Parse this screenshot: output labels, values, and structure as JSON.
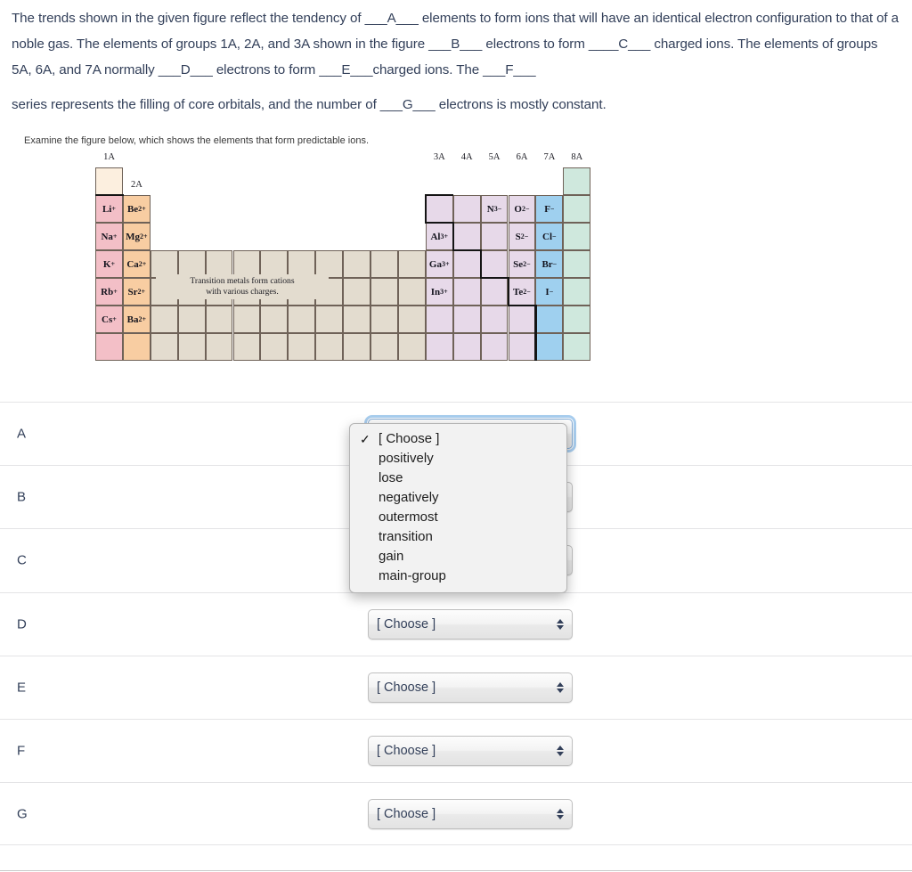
{
  "question": {
    "paragraph1": "The trends shown in the given figure reflect the tendency of ___A___ elements to form ions that will have an identical electron configuration to that of a noble gas. The elements of groups 1A, 2A, and 3A shown in the figure ___B___ electrons to form ____C___ charged ions. The elements of groups 5A, 6A, and 7A normally ___D___ electrons to form ___E___charged ions. The ___F___",
    "paragraph2": "series represents the filling of core orbitals, and the number of ___G___ electrons is mostly constant."
  },
  "figure": {
    "caption": "Examine the figure below, which shows the elements that form predictable ions.",
    "transition_note_line1": "Transition metals form cations",
    "transition_note_line2": "with various charges.",
    "group_labels": {
      "g1a": "1A",
      "g2a": "2A",
      "g3a": "3A",
      "g4a": "4A",
      "g5a": "5A",
      "g6a": "6A",
      "g7a": "7A",
      "g8a": "8A"
    },
    "ions": {
      "col1a": [
        "Li",
        "Na",
        "K",
        "Rb",
        "Cs"
      ],
      "col1a_charge": "+",
      "col2a": [
        "Be",
        "Mg",
        "Ca",
        "Sr",
        "Ba"
      ],
      "col2a_charge": "2+",
      "col3a": [
        "",
        "Al",
        "Ga",
        "In"
      ],
      "col3a_charge": "3+",
      "n_ion": {
        "symbol": "N",
        "charge": "3−"
      },
      "o_ion": {
        "symbol": "O",
        "charge": "2−"
      },
      "s_ion": {
        "symbol": "S",
        "charge": "2−"
      },
      "se_ion": {
        "symbol": "Se",
        "charge": "2−"
      },
      "te_ion": {
        "symbol": "Te",
        "charge": "2−"
      },
      "f_ion": {
        "symbol": "F",
        "charge": "−"
      },
      "cl_ion": {
        "symbol": "Cl",
        "charge": "−"
      },
      "br_ion": {
        "symbol": "Br",
        "charge": "−"
      },
      "i_ion": {
        "symbol": "I",
        "charge": "−"
      }
    },
    "colors": {
      "group1a": "#f3bfc7",
      "group2a": "#f8cda2",
      "transition": "#e3dccf",
      "pblock": "#e7d9e9",
      "group7a": "#9fd0ef",
      "group8a": "#cfe8dd",
      "hydrogen": "#fcefdf",
      "border": "#6f6258"
    }
  },
  "answers": {
    "placeholder": "[ Choose ]",
    "rows": [
      {
        "label": "A",
        "value": "[ Choose ]"
      },
      {
        "label": "B",
        "value": "[ Choose ]"
      },
      {
        "label": "C",
        "value": "[ Choose ]"
      },
      {
        "label": "D",
        "value": "[ Choose ]"
      },
      {
        "label": "E",
        "value": "[ Choose ]"
      },
      {
        "label": "F",
        "value": "[ Choose ]"
      },
      {
        "label": "G",
        "value": "[ Choose ]"
      }
    ]
  },
  "dropdown": {
    "open_for_row": "A",
    "selected": "[ Choose ]",
    "check_glyph": "✓",
    "options": [
      "[ Choose ]",
      "positively",
      "lose",
      "negatively",
      "outermost",
      "transition",
      "gain",
      "main-group"
    ]
  }
}
